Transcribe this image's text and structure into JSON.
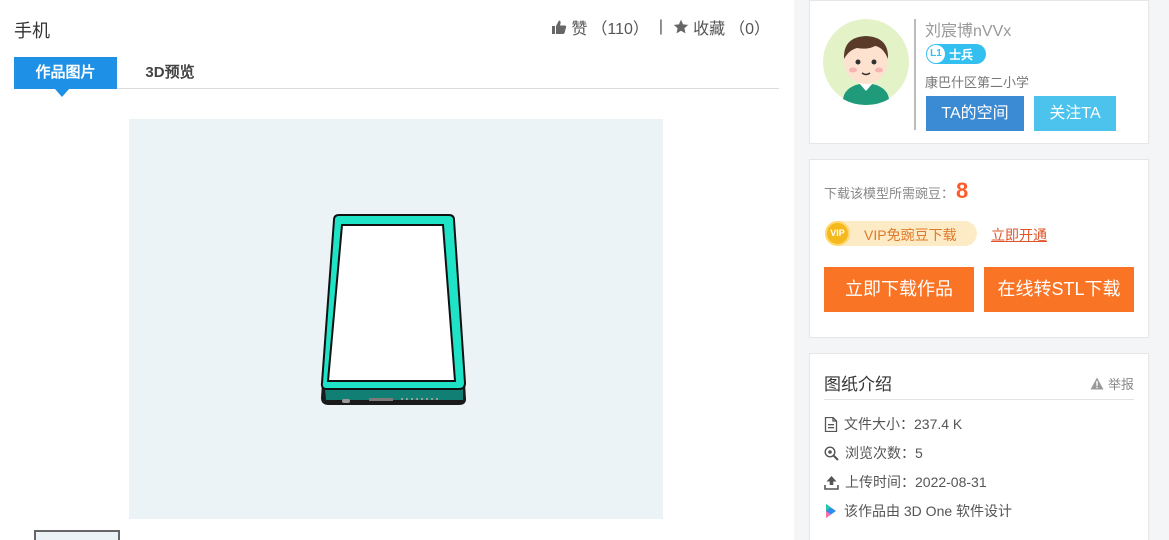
{
  "title": "手机",
  "actions": {
    "like_label": "赞",
    "like_count": "（110）",
    "separator": "|",
    "fav_label": "收藏",
    "fav_count": "（0）"
  },
  "tabs": [
    {
      "label": "作品图片",
      "active": true
    },
    {
      "label": "3D预览",
      "active": false
    }
  ],
  "preview": {
    "icon": "phone-model-render"
  },
  "user": {
    "name": "刘宸博nVVx",
    "level": "L1",
    "rank": "士兵",
    "school": "康巴什区第二小学",
    "space_button": "TA的空间",
    "follow_button": "关注TA"
  },
  "download": {
    "cost_label": "下载该模型所需豌豆：",
    "cost_value": "8",
    "vip_coin": "VIP",
    "vip_text": "VIP免豌豆下载",
    "open_link": "立即开通",
    "download_button": "立即下载作品",
    "stl_button": "在线转STL下载"
  },
  "intro": {
    "title": "图纸介绍",
    "report": "举报",
    "items": [
      {
        "label": "文件大小：",
        "value": "237.4 K",
        "icon": "file-icon"
      },
      {
        "label": "浏览次数：",
        "value": "5",
        "icon": "views-icon"
      },
      {
        "label": "上传时间：",
        "value": "2022-08-31",
        "icon": "upload-icon"
      },
      {
        "label": "该作品由 3D One 软件设计",
        "value": "",
        "icon": "3done-logo-icon"
      }
    ]
  },
  "colors": {
    "accent": "#1e90e6",
    "download": "#f97425",
    "price": "#ff5a2a",
    "phone": "#1fe3c6"
  }
}
